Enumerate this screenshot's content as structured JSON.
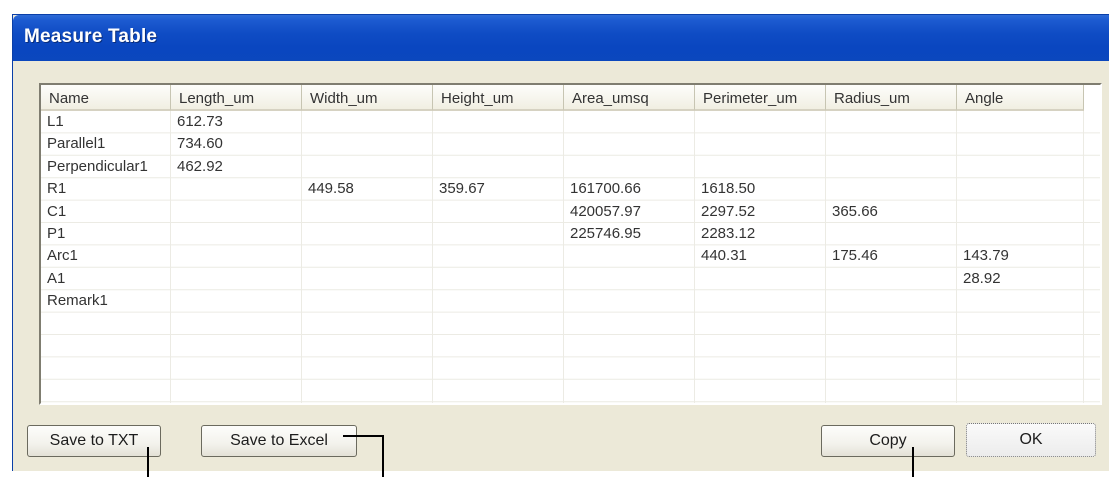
{
  "window": {
    "title": "Measure Table"
  },
  "table": {
    "columns": [
      "Name",
      "Length_um",
      "Width_um",
      "Height_um",
      "Area_umsq",
      "Perimeter_um",
      "Radius_um",
      "Angle"
    ],
    "rows": [
      [
        "L1",
        "612.73",
        "",
        "",
        "",
        "",
        "",
        ""
      ],
      [
        "Parallel1",
        "734.60",
        "",
        "",
        "",
        "",
        "",
        ""
      ],
      [
        "Perpendicular1",
        "462.92",
        "",
        "",
        "",
        "",
        "",
        ""
      ],
      [
        "R1",
        "",
        "449.58",
        "359.67",
        "161700.66",
        "1618.50",
        "",
        ""
      ],
      [
        "C1",
        "",
        "",
        "",
        "420057.97",
        "2297.52",
        "365.66",
        ""
      ],
      [
        "P1",
        "",
        "",
        "",
        "225746.95",
        "2283.12",
        "",
        ""
      ],
      [
        "Arc1",
        "",
        "",
        "",
        "",
        "440.31",
        "175.46",
        "143.79"
      ],
      [
        "A1",
        "",
        "",
        "",
        "",
        "",
        "",
        "28.92"
      ],
      [
        "Remark1",
        "",
        "",
        "",
        "",
        "",
        "",
        ""
      ],
      [
        "",
        "",
        "",
        "",
        "",
        "",
        "",
        ""
      ],
      [
        "",
        "",
        "",
        "",
        "",
        "",
        "",
        ""
      ],
      [
        "",
        "",
        "",
        "",
        "",
        "",
        "",
        ""
      ],
      [
        "",
        "",
        "",
        "",
        "",
        "",
        "",
        ""
      ]
    ]
  },
  "buttons": {
    "save_txt": "Save to TXT",
    "save_excel": "Save to Excel",
    "copy": "Copy",
    "ok": "OK"
  }
}
